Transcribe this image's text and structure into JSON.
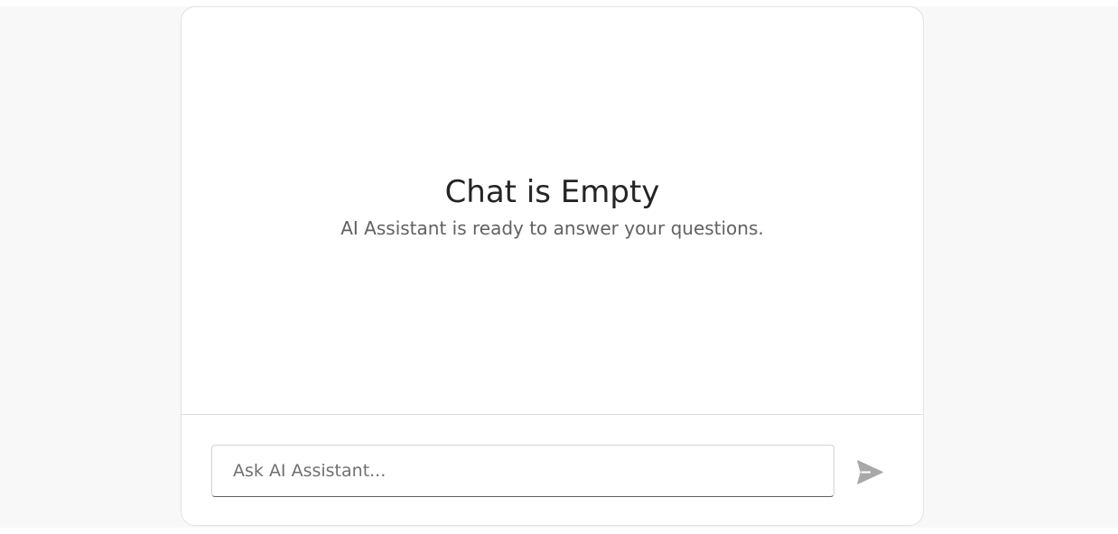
{
  "empty_state": {
    "title": "Chat is Empty",
    "subtitle": "AI Assistant is ready to answer your questions."
  },
  "composer": {
    "input_value": "",
    "input_placeholder": "Ask AI Assistant...",
    "send_icon": "send-icon"
  },
  "colors": {
    "page_background": "#f8f8f8",
    "card_background": "#ffffff",
    "title_text": "#242424",
    "subtitle_text": "#616161",
    "send_icon_disabled": "#a8a8a8"
  }
}
